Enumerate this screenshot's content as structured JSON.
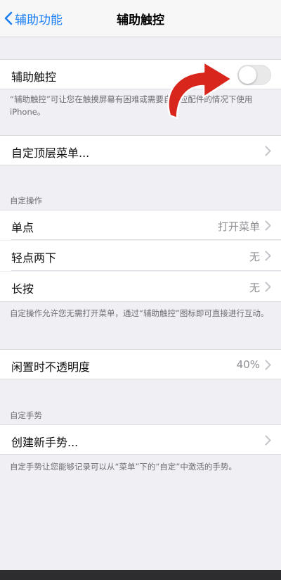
{
  "nav": {
    "back_label": "辅助功能",
    "title": "辅助触控"
  },
  "assistive_touch": {
    "label": "辅助触控",
    "toggle_on": false,
    "description": "“辅助触控”可让您在触摸屏幕有困难或需要自适应配件的情况下使用 iPhone。"
  },
  "top_menu": {
    "label": "自定顶层菜单..."
  },
  "custom_actions": {
    "header": "自定操作",
    "rows": [
      {
        "label": "单点",
        "value": "打开菜单"
      },
      {
        "label": "轻点两下",
        "value": "无"
      },
      {
        "label": "长按",
        "value": "无"
      }
    ],
    "footer": "自定操作允许您无需打开菜单，通过“辅助触控”图标即可直接进行互动。"
  },
  "idle_opacity": {
    "label": "闲置时不透明度",
    "value": "40%"
  },
  "custom_gestures": {
    "header": "自定手势",
    "create_label": "创建新手势...",
    "footer": "自定手势让您能够记录可以从“菜单”下的“自定”中激活的手势。"
  },
  "colors": {
    "accent": "#1a7ff5",
    "annotation_arrow": "#d8261c"
  }
}
